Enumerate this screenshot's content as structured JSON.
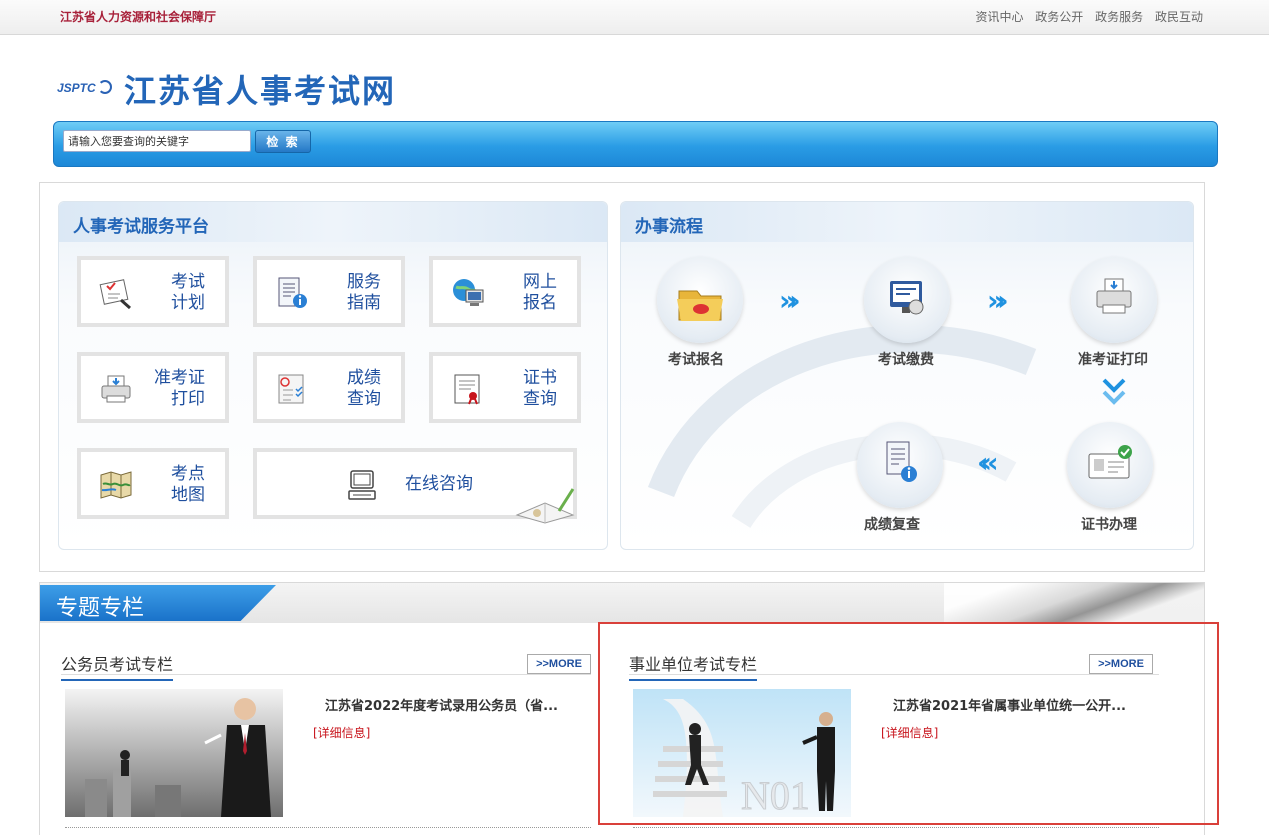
{
  "topbar": {
    "org": "江苏省人力资源和社会保障厅",
    "nav": [
      "资讯中心",
      "政务公开",
      "政务服务",
      "政民互动"
    ]
  },
  "header": {
    "logo_mark": "JSPTC",
    "site_title": "江苏省人事考试网"
  },
  "search": {
    "placeholder": "请输入您要查询的关键字",
    "button": "检 索"
  },
  "services": {
    "title": "人事考试服务平台",
    "items": [
      {
        "line1": "考试",
        "line2": "计划"
      },
      {
        "line1": "服务",
        "line2": "指南"
      },
      {
        "line1": "网上",
        "line2": "报名"
      },
      {
        "line1": "准考证",
        "line2": "打印"
      },
      {
        "line1": "成绩",
        "line2": "查询"
      },
      {
        "line1": "证书",
        "line2": "查询"
      },
      {
        "line1": "考点",
        "line2": "地图"
      }
    ],
    "consult": "在线咨询"
  },
  "workflow": {
    "title": "办事流程",
    "steps": [
      "考试报名",
      "考试缴费",
      "准考证打印",
      "成绩复查",
      "证书办理"
    ]
  },
  "special": {
    "title": "专题专栏",
    "columns": [
      {
        "title": "公务员考试专栏",
        "more": ">>MORE",
        "news": "江苏省2022年度考试录用公务员（省...",
        "detail": "[详细信息]"
      },
      {
        "title": "事业单位考试专栏",
        "more": ">>MORE",
        "news": "江苏省2021年省属事业单位统一公开...",
        "detail": "[详细信息]"
      }
    ]
  }
}
